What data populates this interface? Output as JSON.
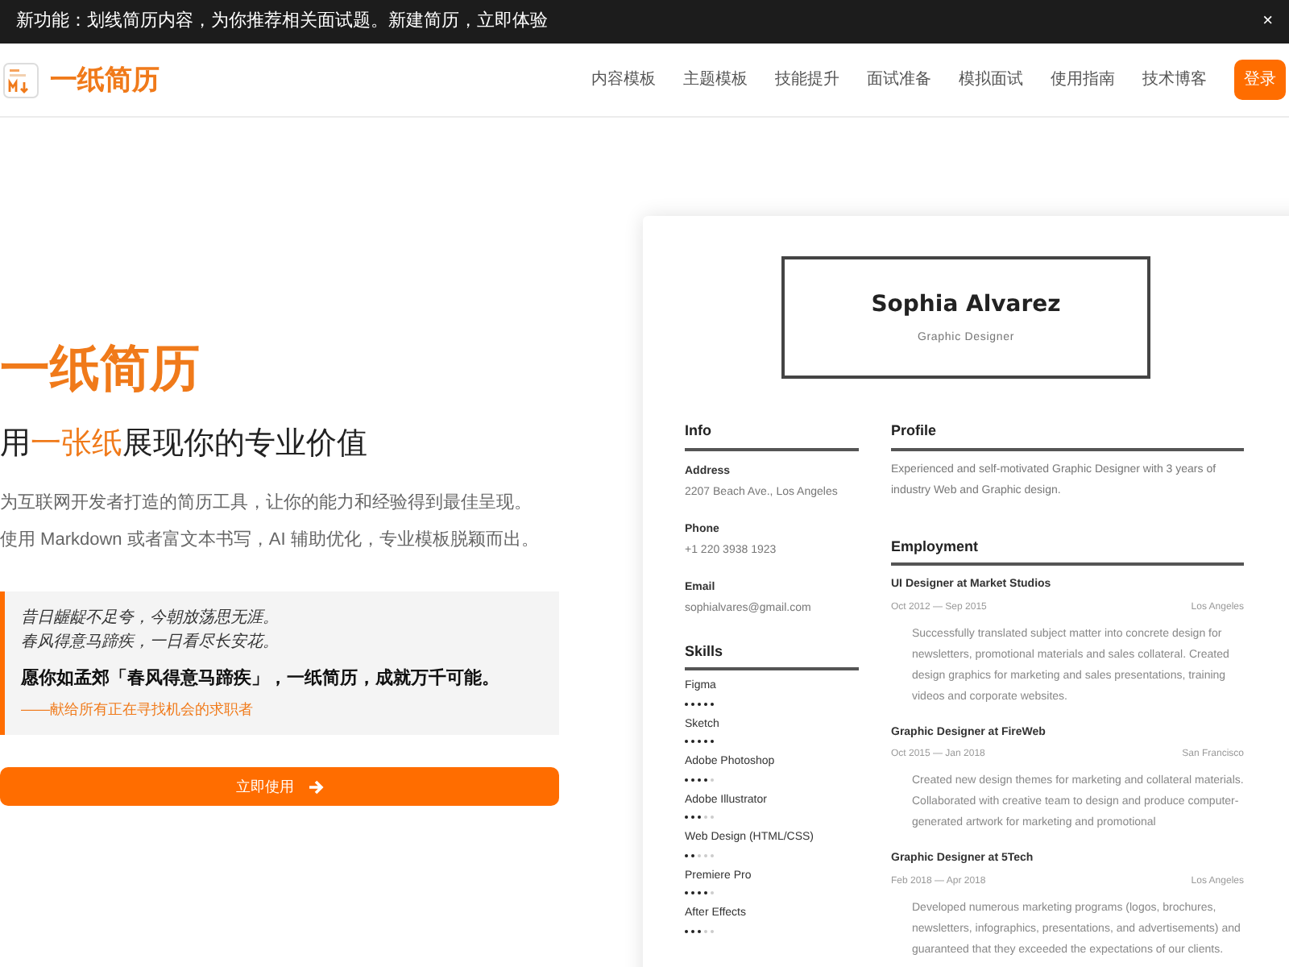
{
  "announcement": {
    "text": "新功能：划线简历内容，为你推荐相关面试题。新建简历，立即体验",
    "close": "×"
  },
  "header": {
    "brand": "一纸简历",
    "nav": [
      "内容模板",
      "主题模板",
      "技能提升",
      "面试准备",
      "模拟面试",
      "使用指南",
      "技术博客"
    ],
    "login": "登录"
  },
  "hero": {
    "title": "一纸简历",
    "subtitle_before": "用",
    "subtitle_highlight": "一张纸",
    "subtitle_after": "展现你的专业价值",
    "description": [
      "为互联网开发者打造的简历工具，让你的能力和经验得到最佳呈现。",
      "使用 Markdown 或者富文本书写，AI 辅助优化，专业模板脱颖而出。"
    ],
    "quote": {
      "lines": [
        "昔日龌龊不足夸，今朝放荡思无涯。",
        "春风得意马蹄疾，一日看尽长安花。"
      ],
      "wish": "愿你如孟郊「春风得意马蹄疾」，一纸简历，成就万千可能。",
      "dedication": "——献给所有正在寻找机会的求职者"
    },
    "cta": "立即使用"
  },
  "resume": {
    "name": "Sophia Alvarez",
    "role": "Graphic Designer",
    "info_title": "Info",
    "info": [
      {
        "label": "Address",
        "value": "2207 Beach Ave., Los Angeles"
      },
      {
        "label": "Phone",
        "value": "+1 220 3938 1923"
      },
      {
        "label": "Email",
        "value": "sophialvares@gmail.com"
      }
    ],
    "skills_title": "Skills",
    "skills": [
      {
        "name": "Figma",
        "stars": 5
      },
      {
        "name": "Sketch",
        "stars": 5
      },
      {
        "name": "Adobe Photoshop",
        "stars": 4
      },
      {
        "name": "Adobe Illustrator",
        "stars": 3
      },
      {
        "name": "Web Design (HTML/CSS)",
        "stars": 2
      },
      {
        "name": "Premiere Pro",
        "stars": 4
      },
      {
        "name": "After Effects",
        "stars": 3
      }
    ],
    "profile_title": "Profile",
    "profile": "Experienced and self-motivated Graphic Designer with 3 years of industry Web and Graphic design.",
    "employment_title": "Employment",
    "jobs": [
      {
        "title": "UI Designer at Market Studios",
        "dates": "Oct 2012 — Sep 2015",
        "location": "Los Angeles",
        "description": "Successfully translated subject matter into concrete design for newsletters, promotional materials and sales collateral. Created design graphics for marketing and sales presentations, training videos and corporate websites."
      },
      {
        "title": "Graphic Designer at FireWeb",
        "dates": "Oct 2015 — Jan 2018",
        "location": "San Francisco",
        "description": "Created new design themes for marketing and collateral materials. Collaborated with creative team to design and produce computer-generated artwork for marketing and promotional"
      },
      {
        "title": "Graphic Designer at 5Tech",
        "dates": "Feb 2018 — Apr 2018",
        "location": "Los Angeles",
        "description": "Developed numerous marketing programs (logos, brochures, newsletters, infographics, presentations, and advertisements) and guaranteed that they exceeded the expectations of our clients."
      }
    ]
  }
}
